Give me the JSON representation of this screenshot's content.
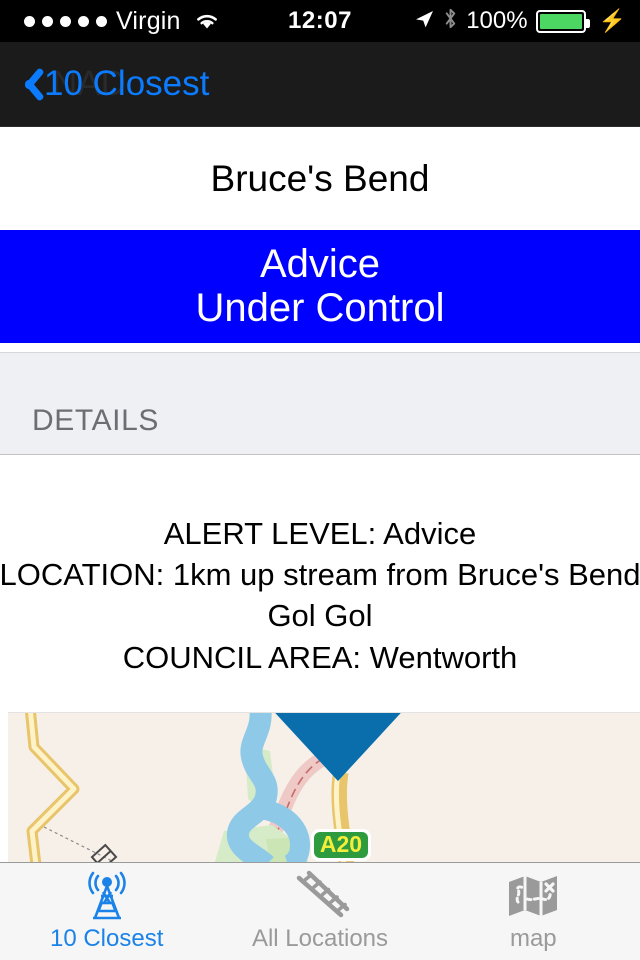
{
  "status_bar": {
    "signal_dots": 5,
    "carrier": "Virgin",
    "wifi_icon": "wifi-icon",
    "time": "12:07",
    "location_icon": "location-arrow-icon",
    "bluetooth_icon": "bluetooth-icon",
    "battery_percent": "100%",
    "battery_charging_icon": "lightning-bolt-icon",
    "battery_color": "#4cd662"
  },
  "nav_bar": {
    "back_label": "10 Closest",
    "back_icon": "chevron-left-icon",
    "ghost_title": "NAD",
    "accent_color": "#0b7bff",
    "background_color": "#1b1b1b"
  },
  "title_cell": {
    "title": "Bruce's Bend"
  },
  "alert_banner": {
    "level": "Advice",
    "status": "Under Control",
    "background_color": "#0000ff",
    "text_color": "#ffffff"
  },
  "details_section": {
    "header": "DETAILS",
    "lines": [
      "ALERT LEVEL: Advice",
      "LOCATION: 1km up stream from Bruce's Bend",
      "Gol Gol",
      "COUNCIL AREA: Wentworth"
    ]
  },
  "map": {
    "marker_icon": "map-pin-triangle-icon",
    "marker_color": "#0a6ead",
    "road_shield_label": "A20",
    "road_shield_color": "#2e9b3e",
    "road_shield_text_color": "#f5ed3b",
    "land_color": "#f7f0e8",
    "water_color": "#8ec9e8",
    "park_color": "#d6ecc8",
    "road_color": "#f3d98e",
    "boundary_color": "#e8a9a9"
  },
  "tab_bar": {
    "tabs": [
      {
        "label": "10 Closest",
        "icon": "radio-tower-icon",
        "active": true
      },
      {
        "label": "All Locations",
        "icon": "railroad-ladder-icon",
        "active": false
      },
      {
        "label": "map",
        "icon": "folded-map-icon",
        "active": false
      }
    ],
    "active_color": "#1b83e8",
    "inactive_color": "#9a9a9a"
  }
}
